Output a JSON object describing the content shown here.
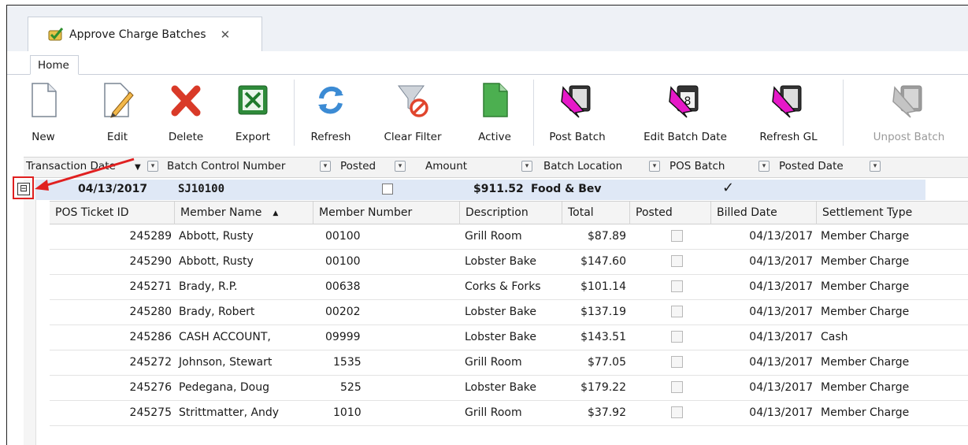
{
  "window": {
    "tab_title": "Approve Charge Batches",
    "tab_close": "✕"
  },
  "ribbon_tab": "Home",
  "toolbar": {
    "new": "New",
    "edit": "Edit",
    "delete": "Delete",
    "export": "Export",
    "refresh": "Refresh",
    "clear_filter": "Clear Filter",
    "active": "Active",
    "post_batch": "Post Batch",
    "edit_batch_date": "Edit Batch Date",
    "refresh_gl": "Refresh GL",
    "unpost_batch": "Unpost Batch"
  },
  "filter_columns": [
    "Transaction Date",
    "Batch Control Number",
    "Posted",
    "Amount",
    "Batch Location",
    "POS Batch",
    "Posted Date"
  ],
  "group": {
    "expander": "⊟",
    "date": "04/13/2017",
    "batch": "SJ10100",
    "posted": false,
    "amount": "$911.52",
    "location": "Food & Bev",
    "pos_batch_check": "✓"
  },
  "columns": [
    "POS Ticket ID",
    "Member Name",
    "Member Number",
    "Description",
    "Total",
    "Posted",
    "Billed Date",
    "Settlement Type"
  ],
  "rows": [
    {
      "id": "245289",
      "name": "Abbott, Rusty",
      "number": "00100",
      "desc": "Grill Room",
      "total": "$87.89",
      "billed": "04/13/2017",
      "type": "Member Charge"
    },
    {
      "id": "245290",
      "name": "Abbott, Rusty",
      "number": "00100",
      "desc": "Lobster Bake",
      "total": "$147.60",
      "billed": "04/13/2017",
      "type": "Member Charge"
    },
    {
      "id": "245271",
      "name": "Brady, R.P.",
      "number": "00638",
      "desc": "Corks & Forks",
      "total": "$101.14",
      "billed": "04/13/2017",
      "type": "Member Charge"
    },
    {
      "id": "245280",
      "name": "Brady, Robert",
      "number": "00202",
      "desc": "Lobster Bake",
      "total": "$137.19",
      "billed": "04/13/2017",
      "type": "Member Charge"
    },
    {
      "id": "245286",
      "name": "CASH ACCOUNT,",
      "number": "09999",
      "desc": "Lobster Bake",
      "total": "$143.51",
      "billed": "04/13/2017",
      "type": "Cash"
    },
    {
      "id": "245272",
      "name": "Johnson, Stewart",
      "number": "1535",
      "desc": "Grill Room",
      "total": "$77.05",
      "billed": "04/13/2017",
      "type": "Member Charge"
    },
    {
      "id": "245276",
      "name": "Pedegana, Doug",
      "number": "525",
      "desc": "Lobster Bake",
      "total": "$179.22",
      "billed": "04/13/2017",
      "type": "Member Charge"
    },
    {
      "id": "245275",
      "name": "Strittmatter, Andy",
      "number": "1010",
      "desc": "Grill Room",
      "total": "$37.92",
      "billed": "04/13/2017",
      "type": "Member Charge"
    }
  ],
  "colors": {
    "accent_red": "#e02020",
    "group_bg": "#dfe8f6",
    "magenta": "#e619c8"
  }
}
